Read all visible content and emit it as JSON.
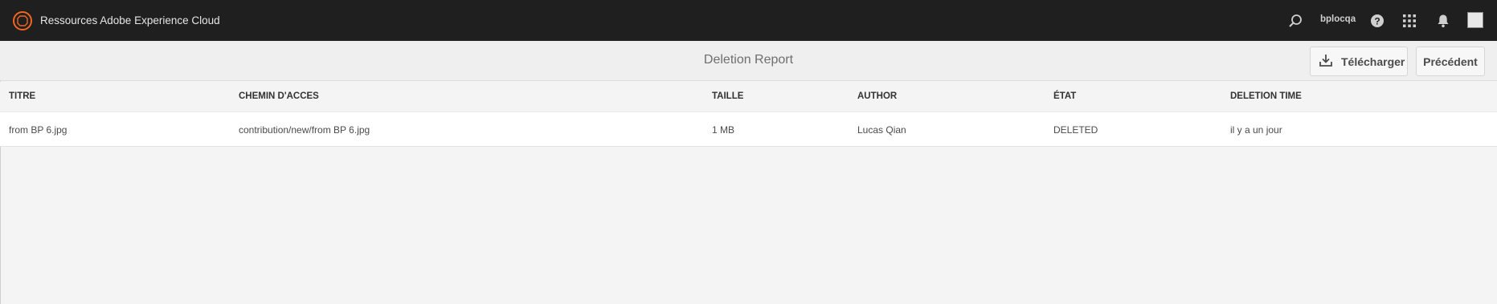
{
  "app": {
    "title": "Ressources Adobe Experience Cloud",
    "logo_icon": "adobe-experience-cloud-logo-icon",
    "accent_color": "#f26522"
  },
  "header": {
    "username": "bplocqa",
    "icons": [
      "search-icon",
      "help-icon",
      "apps-grid-icon",
      "bell-icon",
      "avatar-image"
    ]
  },
  "actionbar": {
    "title": "Deletion Report",
    "download_label": "Télécharger",
    "back_label": "Précédent"
  },
  "table": {
    "columns": [
      "TITRE",
      "CHEMIN D'ACCES",
      "TAILLE",
      "AUTHOR",
      "ÉTAT",
      "DELETION TIME"
    ],
    "rows": [
      [
        "from BP 6.jpg",
        "contribution/new/from BP 6.jpg",
        "1 MB",
        "Lucas Qian",
        "DELETED",
        "il y a un jour"
      ]
    ]
  }
}
